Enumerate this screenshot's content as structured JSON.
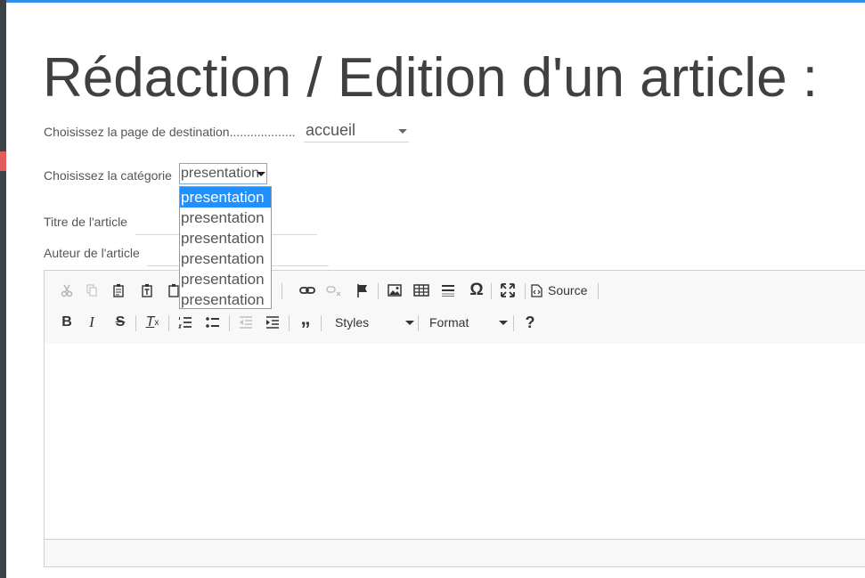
{
  "page": {
    "title": "Rédaction / Edition d'un article :"
  },
  "form": {
    "destination_label": "Choisissez la page de destination...................",
    "destination_value": "accueil",
    "category_label": "Choisissez la catégorie",
    "category_value": "presentation",
    "category_options": [
      "presentation",
      "presentation",
      "presentation",
      "presentation",
      "presentation",
      "presentation"
    ],
    "title_label": "Titre de l'article",
    "author_label": "Auteur de l'article"
  },
  "editor": {
    "source_label": "Source",
    "styles_label": "Styles",
    "format_label": "Format",
    "help_label": "?"
  },
  "colors": {
    "accent": "#2f8fe6",
    "selected_option": "#1e90ff",
    "side_mark": "#e35b5b"
  }
}
